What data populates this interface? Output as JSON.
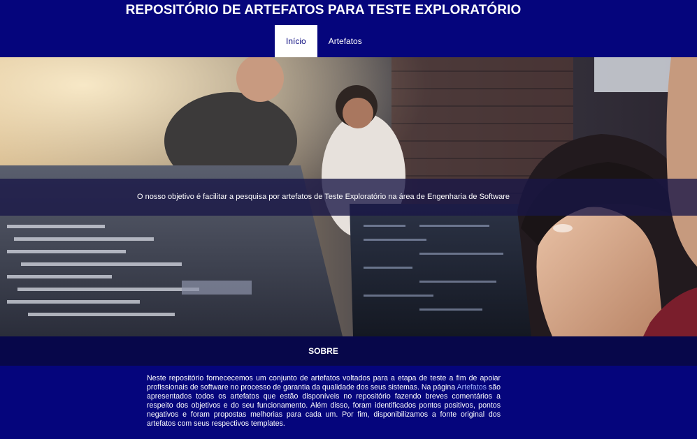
{
  "header": {
    "title": "REPOSITÓRIO DE ARTEFATOS PARA TESTE EXPLORATÓRIO",
    "nav": [
      {
        "label": "Início",
        "active": true
      },
      {
        "label": "Artefatos",
        "active": false
      }
    ]
  },
  "hero": {
    "tagline": "O nosso objetivo é facilitar a pesquisa por artefatos de Teste Exploratório na área de Engenharia de Software"
  },
  "about": {
    "title": "SOBRE",
    "text_before": "Neste repositório fornececemos um conjunto de artefatos voltados para a etapa de teste a fim de apoiar profissionais de software no processo de garantia da qualidade dos seus sistemas. Na página ",
    "link_label": "Artefatos",
    "text_after": " são apresentados todos os artefatos que estão disponíveis no repositório fazendo breves comentários a respeito dos objetivos e do seu funcionamento. Além disso, foram identificados pontos positivos, pontos negativos e foram propostas melhorias para cada um. Por fim, disponibilizamos a fonte original dos artefatos com seus respectivos templates."
  },
  "colors": {
    "primary": "#05057c",
    "section_bar": "#07074a",
    "link": "#9fb2ff"
  }
}
